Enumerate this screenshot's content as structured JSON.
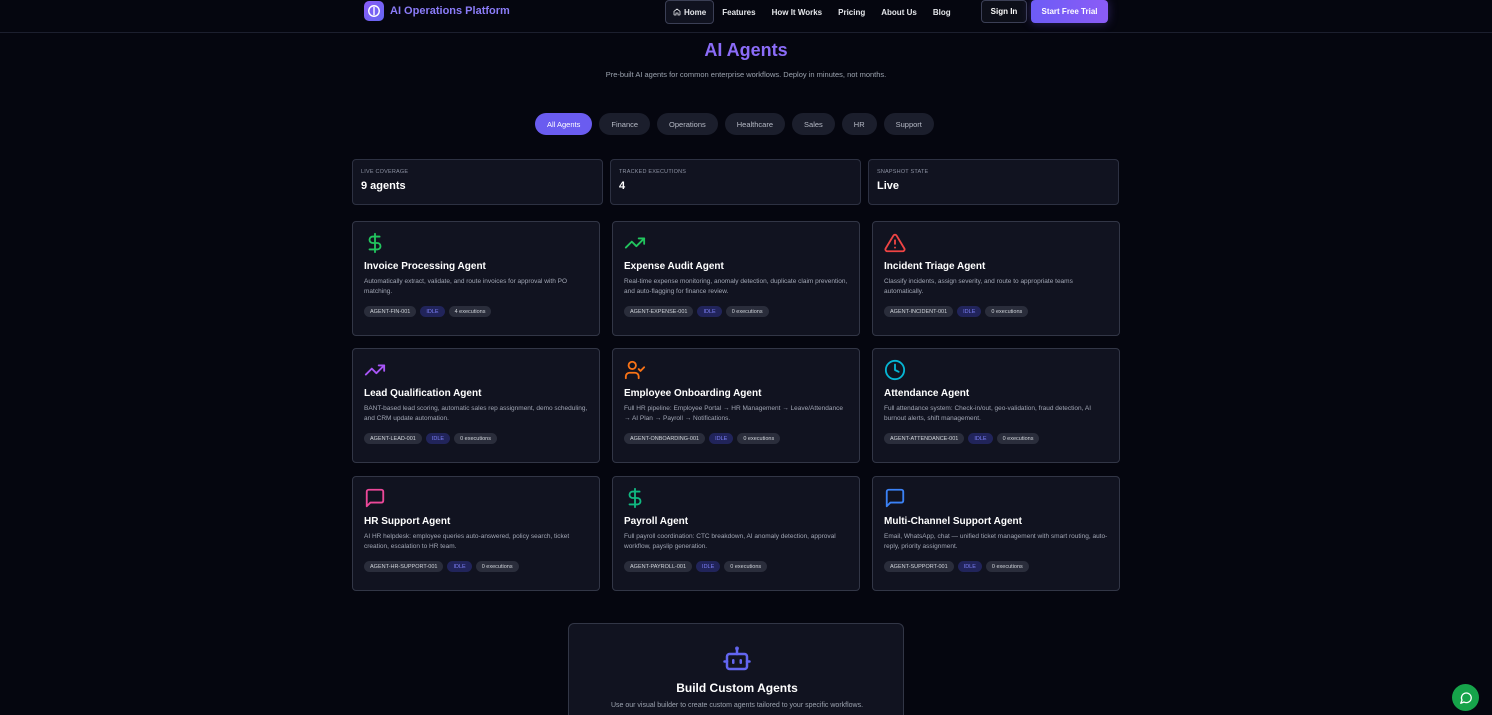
{
  "nav": {
    "brand": "AI Operations Platform",
    "links": [
      "Home",
      "Features",
      "How It Works",
      "Pricing",
      "About Us",
      "Blog"
    ],
    "signin": "Sign In",
    "trial": "Start Free Trial"
  },
  "header": {
    "title": "AI Agents",
    "subtitle": "Pre-built AI agents for common enterprise workflows. Deploy in minutes, not months."
  },
  "filters": [
    "All Agents",
    "Finance",
    "Operations",
    "Healthcare",
    "Sales",
    "HR",
    "Support"
  ],
  "stats": [
    {
      "label": "Live coverage",
      "value": "9 agents"
    },
    {
      "label": "Tracked executions",
      "value": "4"
    },
    {
      "label": "Snapshot state",
      "value": "Live"
    }
  ],
  "agents": [
    {
      "title": "Invoice Processing Agent",
      "desc": "Automatically extract, validate, and route invoices for approval with PO matching.",
      "id": "AGENT-FIN-001",
      "status": "IDLE",
      "executions": "4 executions",
      "icon": "dollar-icon",
      "color": "#22c55e"
    },
    {
      "title": "Expense Audit Agent",
      "desc": "Real-time expense monitoring, anomaly detection, duplicate claim prevention, and auto-flagging for finance review.",
      "id": "AGENT-EXPENSE-001",
      "status": "IDLE",
      "executions": "0 executions",
      "icon": "trending-up-icon",
      "color": "#22c55e"
    },
    {
      "title": "Incident Triage Agent",
      "desc": "Classify incidents, assign severity, and route to appropriate teams automatically.",
      "id": "AGENT-INCIDENT-001",
      "status": "IDLE",
      "executions": "0 executions",
      "icon": "alert-triangle-icon",
      "color": "#ef4444"
    },
    {
      "title": "Lead Qualification Agent",
      "desc": "BANT-based lead scoring, automatic sales rep assignment, demo scheduling, and CRM update automation.",
      "id": "AGENT-LEAD-001",
      "status": "IDLE",
      "executions": "0 executions",
      "icon": "trending-up-icon",
      "color": "#a855f7"
    },
    {
      "title": "Employee Onboarding Agent",
      "desc": "Full HR pipeline: Employee Portal → HR Management → Leave/Attendance → AI Plan → Payroll → Notifications.",
      "id": "AGENT-ONBOARDING-001",
      "status": "IDLE",
      "executions": "0 executions",
      "icon": "user-check-icon",
      "color": "#f97316"
    },
    {
      "title": "Attendance Agent",
      "desc": "Full attendance system: Check-in/out, geo-validation, fraud detection, AI burnout alerts, shift management.",
      "id": "AGENT-ATTENDANCE-001",
      "status": "IDLE",
      "executions": "0 executions",
      "icon": "clock-icon",
      "color": "#06b6d4"
    },
    {
      "title": "HR Support Agent",
      "desc": "AI HR helpdesk: employee queries auto-answered, policy search, ticket creation, escalation to HR team.",
      "id": "AGENT-HR-SUPPORT-001",
      "status": "IDLE",
      "executions": "0 executions",
      "icon": "message-square-icon",
      "color": "#ec4899"
    },
    {
      "title": "Payroll Agent",
      "desc": "Full payroll coordination: CTC breakdown, AI anomaly detection, approval workflow, payslip generation.",
      "id": "AGENT-PAYROLL-001",
      "status": "IDLE",
      "executions": "0 executions",
      "icon": "dollar-icon",
      "color": "#10b981"
    },
    {
      "title": "Multi-Channel Support Agent",
      "desc": "Email, WhatsApp, chat — unified ticket management with smart routing, auto-reply, priority assignment.",
      "id": "AGENT-SUPPORT-001",
      "status": "IDLE",
      "executions": "0 executions",
      "icon": "message-square-icon",
      "color": "#3b82f6"
    }
  ],
  "custom": {
    "title": "Build Custom Agents",
    "desc": "Use our visual builder to create custom agents tailored to your specific workflows.",
    "icon": "bot-icon",
    "color": "#6366f1"
  },
  "fab": {
    "icon": "chat-icon",
    "color": "#16a34a"
  }
}
